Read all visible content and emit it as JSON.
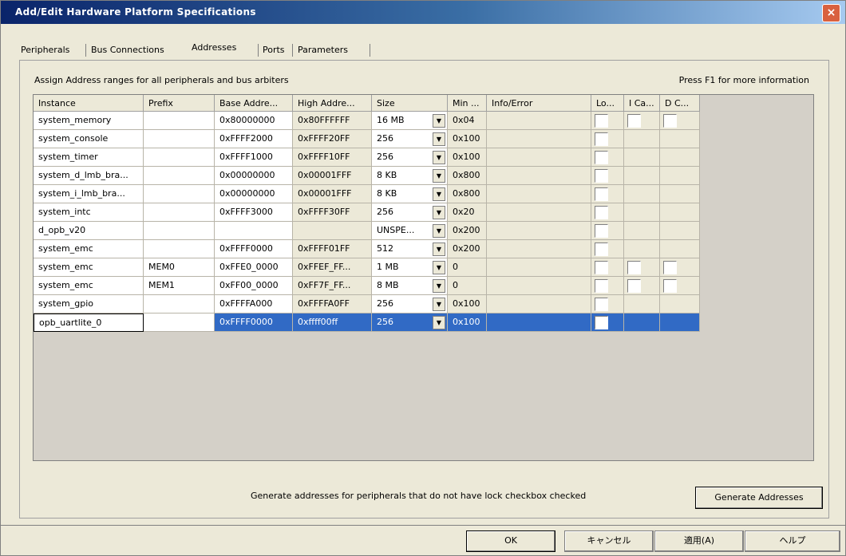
{
  "window": {
    "title": "Add/Edit Hardware Platform Specifications",
    "close_label": "×"
  },
  "tabs": [
    {
      "label": "Peripherals",
      "active": false
    },
    {
      "label": "Bus Connections",
      "active": false
    },
    {
      "label": "Addresses",
      "active": true
    },
    {
      "label": "Ports",
      "active": false
    },
    {
      "label": "Parameters",
      "active": false
    }
  ],
  "panel": {
    "instructions": "Assign Address ranges for all peripherals and bus arbiters",
    "help_hint": "Press F1 for more information"
  },
  "table": {
    "columns": [
      "Instance",
      "Prefix",
      "Base Addre...",
      "High Addre...",
      "Size",
      "Min ...",
      "Info/Error",
      "Lo...",
      "I Ca...",
      "D C..."
    ],
    "rows": [
      {
        "instance": "system_memory",
        "prefix": "",
        "base": "0x80000000",
        "high": "0x80FFFFFF",
        "size": "16 MB",
        "min": "0x04",
        "info": "",
        "lock": true,
        "icache": true,
        "dcache": true
      },
      {
        "instance": "system_console",
        "prefix": "",
        "base": "0xFFFF2000",
        "high": "0xFFFF20FF",
        "size": "256",
        "min": "0x100",
        "info": "",
        "lock": true,
        "icache": false,
        "dcache": false
      },
      {
        "instance": "system_timer",
        "prefix": "",
        "base": "0xFFFF1000",
        "high": "0xFFFF10FF",
        "size": "256",
        "min": "0x100",
        "info": "",
        "lock": true,
        "icache": false,
        "dcache": false
      },
      {
        "instance": "system_d_lmb_bra...",
        "prefix": "",
        "base": "0x00000000",
        "high": "0x00001FFF",
        "size": "8 KB",
        "min": "0x800",
        "info": "",
        "lock": true,
        "icache": false,
        "dcache": false
      },
      {
        "instance": "system_i_lmb_bra...",
        "prefix": "",
        "base": "0x00000000",
        "high": "0x00001FFF",
        "size": "8 KB",
        "min": "0x800",
        "info": "",
        "lock": true,
        "icache": false,
        "dcache": false
      },
      {
        "instance": "system_intc",
        "prefix": "",
        "base": "0xFFFF3000",
        "high": "0xFFFF30FF",
        "size": "256",
        "min": "0x20",
        "info": "",
        "lock": true,
        "icache": false,
        "dcache": false
      },
      {
        "instance": "d_opb_v20",
        "prefix": "",
        "base": "",
        "high": "",
        "size": "UNSPE...",
        "min": "0x200",
        "info": "",
        "lock": true,
        "icache": false,
        "dcache": false
      },
      {
        "instance": "system_emc",
        "prefix": "",
        "base": "0xFFFF0000",
        "high": "0xFFFF01FF",
        "size": "512",
        "min": "0x200",
        "info": "",
        "lock": true,
        "icache": false,
        "dcache": false
      },
      {
        "instance": "system_emc",
        "prefix": "MEM0",
        "base": "0xFFE0_0000",
        "high": "0xFFEF_FF...",
        "size": "1 MB",
        "min": "0",
        "info": "",
        "lock": true,
        "icache": true,
        "dcache": true
      },
      {
        "instance": "system_emc",
        "prefix": "MEM1",
        "base": "0xFF00_0000",
        "high": "0xFF7F_FF...",
        "size": "8 MB",
        "min": "0",
        "info": "",
        "lock": true,
        "icache": true,
        "dcache": true
      },
      {
        "instance": "system_gpio",
        "prefix": "",
        "base": "0xFFFFA000",
        "high": "0xFFFFA0FF",
        "size": "256",
        "min": "0x100",
        "info": "",
        "lock": true,
        "icache": false,
        "dcache": false
      },
      {
        "instance": "opb_uartlite_0",
        "prefix": "",
        "base": "0xFFFF0000",
        "high": "0xffff00ff",
        "size": "256",
        "min": "0x100",
        "info": "",
        "lock": true,
        "icache": false,
        "dcache": false,
        "selected": true
      }
    ]
  },
  "generate": {
    "hint": "Generate addresses for peripherals that do not have lock checkbox checked",
    "button_label": "Generate Addresses"
  },
  "footer": {
    "ok_label": "OK",
    "cancel_label": "キャンセル",
    "apply_label": "適用(A)",
    "help_label": "ヘルプ"
  },
  "colors": {
    "titlebar_start": "#0a246a",
    "titlebar_end": "#a6caf0",
    "selection": "#316ac5",
    "dialog_bg": "#ece9d8"
  }
}
